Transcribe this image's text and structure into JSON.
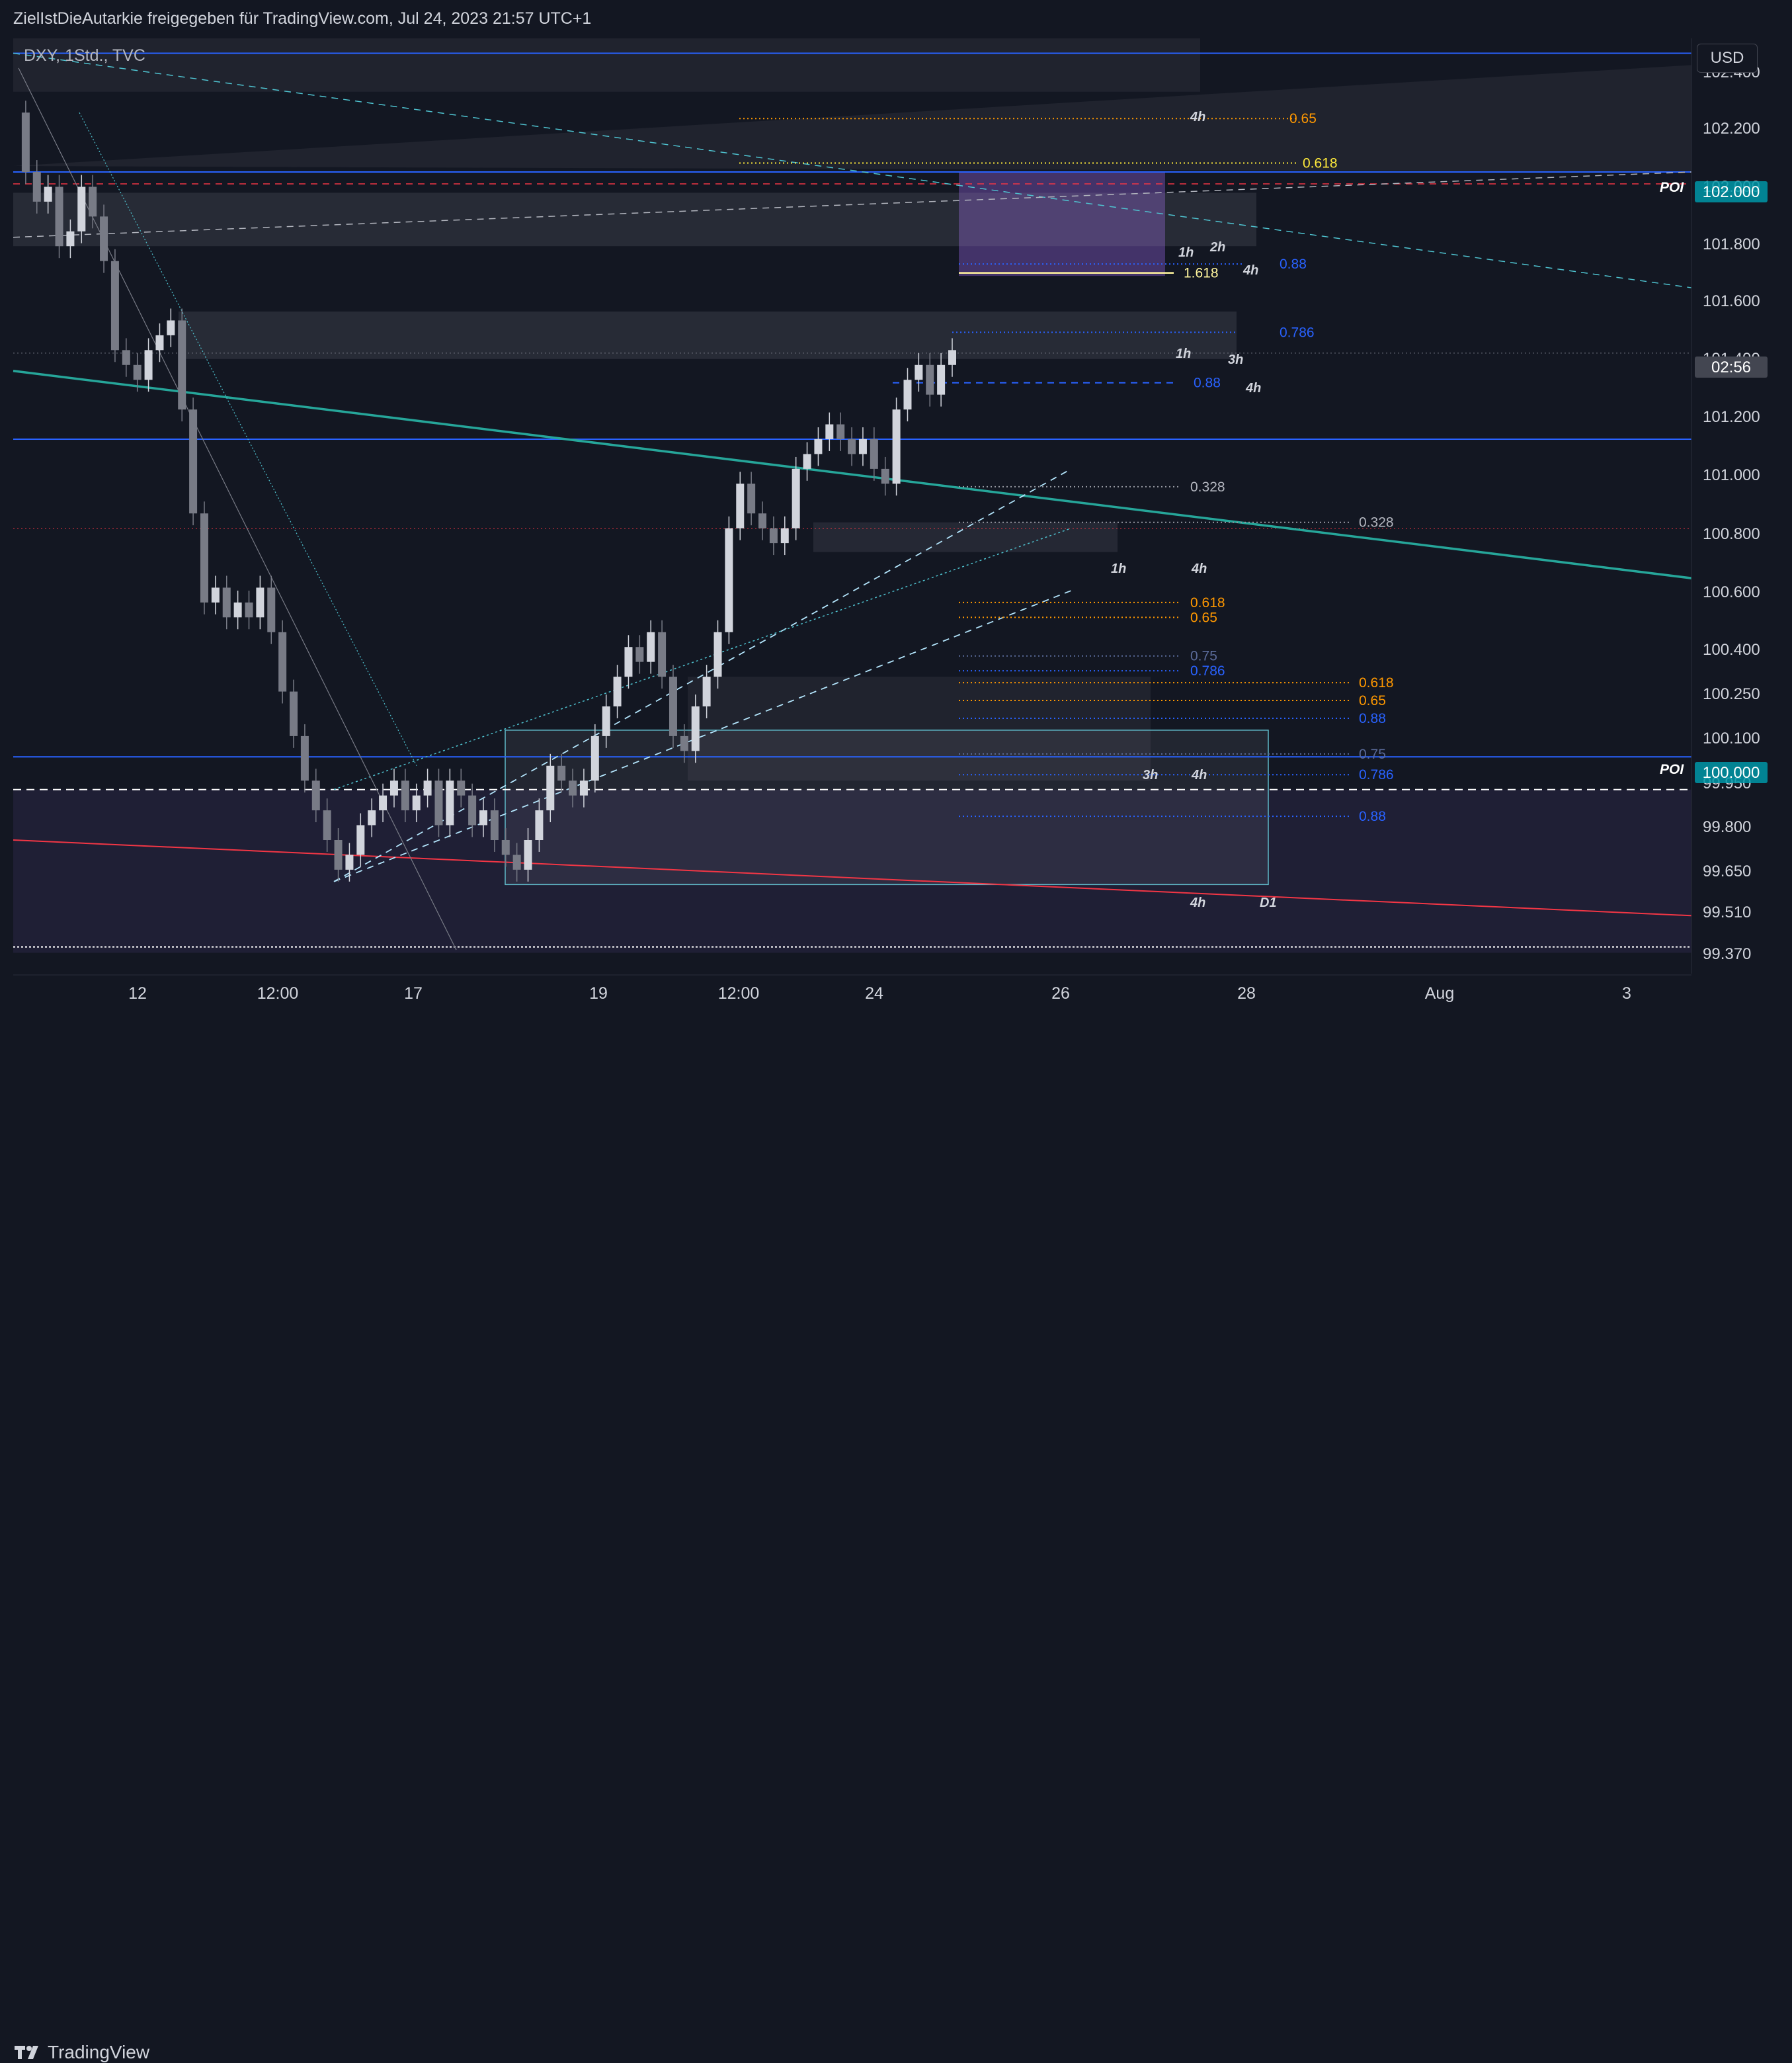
{
  "header": {
    "share_text": "ZielIstDieAutarkie freigegeben für TradingView.com, Jul 24, 2023 21:57 UTC+1"
  },
  "symbol": {
    "label": "DXY, 1Std., TVC"
  },
  "currency": {
    "label": "USD"
  },
  "footer": {
    "brand": "TradingView"
  },
  "colors": {
    "background": "#131722",
    "up": "#d1d4dc",
    "down": "#787b86",
    "blue_line": "#2962ff",
    "teal_trend": "#26a69a",
    "red_trend": "#f23645",
    "orange": "#ff9800",
    "yellow": "#ffeb3b",
    "purple_zone": "#7e57c2",
    "price_tag": "#2962ff"
  },
  "chart_data": {
    "type": "candlestick",
    "title": "DXY, 1Std., TVC",
    "ylabel": "USD",
    "ylim": [
      99.3,
      102.45
    ],
    "y_ticks": [
      "102.400",
      "102.200",
      "102.000",
      "101.800",
      "101.600",
      "101.400",
      "101.200",
      "101.000",
      "100.800",
      "100.600",
      "100.400",
      "100.250",
      "100.100",
      "99.950",
      "99.800",
      "99.650",
      "99.510",
      "99.370"
    ],
    "x_ticks": [
      "12",
      "12:00",
      "17",
      "19",
      "12:00",
      "24",
      "26",
      "28",
      "Aug",
      "3"
    ],
    "price_tags": [
      {
        "text": "102.000",
        "value": 102.0
      },
      {
        "text": "02:56",
        "value": 101.39
      },
      {
        "text": "100.000",
        "value": 100.0
      }
    ],
    "poi_labels": [
      {
        "text": "POI",
        "value": 102.0
      },
      {
        "text": "POI",
        "value": 100.0
      }
    ],
    "close_path": [
      102.2,
      102.0,
      101.9,
      101.95,
      101.75,
      101.8,
      101.95,
      101.85,
      101.7,
      101.4,
      101.35,
      101.3,
      101.4,
      101.45,
      101.5,
      101.2,
      100.85,
      100.55,
      100.6,
      100.5,
      100.55,
      100.5,
      100.6,
      100.45,
      100.25,
      100.1,
      99.95,
      99.85,
      99.75,
      99.65,
      99.7,
      99.8,
      99.85,
      99.9,
      99.95,
      99.85,
      99.9,
      99.95,
      99.8,
      99.95,
      99.9,
      99.8,
      99.85,
      99.75,
      99.7,
      99.65,
      99.75,
      99.85,
      100.0,
      99.95,
      99.9,
      99.95,
      100.1,
      100.2,
      100.3,
      100.4,
      100.35,
      100.45,
      100.3,
      100.1,
      100.05,
      100.2,
      100.3,
      100.45,
      100.8,
      100.95,
      100.85,
      100.8,
      100.75,
      100.8,
      101.0,
      101.05,
      101.1,
      101.15,
      101.1,
      101.05,
      101.1,
      101.0,
      100.95,
      101.2,
      101.3,
      101.35,
      101.25,
      101.35,
      101.4
    ],
    "levels": [
      {
        "label": "0.65",
        "value": 102.18
      },
      {
        "label": "0.618",
        "value": 102.03
      },
      {
        "label": "1.618",
        "value": 101.66
      },
      {
        "label": "0.88",
        "value": 101.69
      },
      {
        "label": "0.786",
        "value": 101.46
      },
      {
        "label": "0.88",
        "value": 101.29
      },
      {
        "label": "0.328",
        "value": 100.94
      },
      {
        "label": "0.328",
        "value": 100.82
      },
      {
        "label": "0.618",
        "value": 100.55
      },
      {
        "label": "0.65",
        "value": 100.5
      },
      {
        "label": "0.75",
        "value": 100.37
      },
      {
        "label": "0.786",
        "value": 100.32
      },
      {
        "label": "0.618",
        "value": 100.28
      },
      {
        "label": "0.65",
        "value": 100.22
      },
      {
        "label": "0.88",
        "value": 100.16
      },
      {
        "label": "0.75",
        "value": 100.04
      },
      {
        "label": "0.786",
        "value": 99.97
      },
      {
        "label": "0.88",
        "value": 99.83
      }
    ],
    "timeframe_labels": [
      "4h",
      "1h",
      "2h",
      "4h",
      "1h",
      "3h",
      "4h",
      "1h",
      "4h",
      "3h",
      "4h",
      "4h",
      "D1"
    ]
  }
}
